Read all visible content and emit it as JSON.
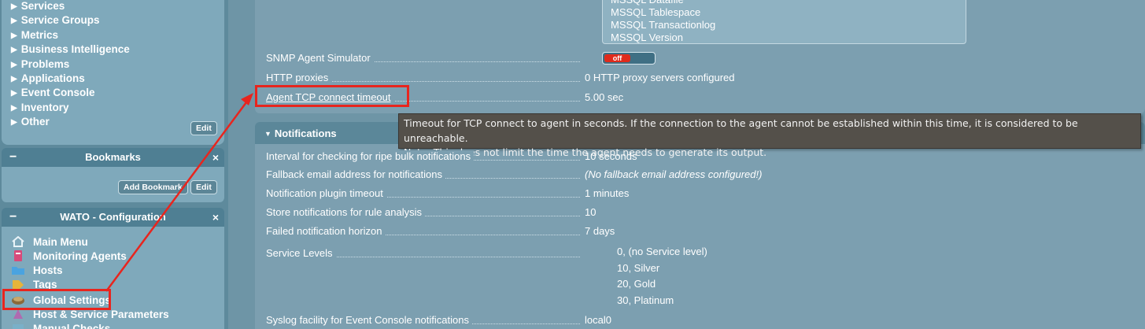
{
  "sidebar": {
    "views_items": [
      {
        "label": "Services"
      },
      {
        "label": "Service Groups"
      },
      {
        "label": "Metrics"
      },
      {
        "label": "Business Intelligence"
      },
      {
        "label": "Problems"
      },
      {
        "label": "Applications"
      },
      {
        "label": "Event Console"
      },
      {
        "label": "Inventory"
      },
      {
        "label": "Other"
      }
    ],
    "views_edit_label": "Edit",
    "bookmarks": {
      "title": "Bookmarks",
      "add_label": "Add Bookmark",
      "edit_label": "Edit"
    },
    "wato": {
      "title": "WATO - Configuration",
      "items": [
        {
          "label": "Main Menu",
          "icon": "home-icon"
        },
        {
          "label": "Monitoring Agents",
          "icon": "agent-icon"
        },
        {
          "label": "Hosts",
          "icon": "folder-icon"
        },
        {
          "label": "Tags",
          "icon": "tag-icon"
        },
        {
          "label": "Global Settings",
          "icon": "settings-icon"
        },
        {
          "label": "Host & Service Parameters",
          "icon": "parameters-icon"
        },
        {
          "label": "Manual Checks",
          "icon": "checks-icon"
        }
      ]
    },
    "minus_symbol": "−",
    "close_symbol": "×"
  },
  "main": {
    "listbox_items": [
      "MSSQL Datafile",
      "MSSQL Tablespace",
      "MSSQL Transactionlog",
      "MSSQL Version"
    ],
    "settings": [
      {
        "label": "SNMP Agent Simulator",
        "value": "off"
      },
      {
        "label": "HTTP proxies",
        "value": "0 HTTP proxy servers configured"
      },
      {
        "label": "Agent TCP connect timeout",
        "value": "5.00 sec"
      }
    ],
    "notifications": {
      "title": "Notifications",
      "rows": [
        {
          "label": "Interval for checking for ripe bulk notifications",
          "value": "10 seconds"
        },
        {
          "label": "Fallback email address for notifications",
          "value": "(No fallback email address configured!)"
        },
        {
          "label": "Notification plugin timeout",
          "value": "1 minutes"
        },
        {
          "label": "Store notifications for rule analysis",
          "value": "10"
        },
        {
          "label": "Failed notification horizon",
          "value": "7 days"
        },
        {
          "label": "Service Levels",
          "value": ""
        },
        {
          "label": "Syslog facility for Event Console notifications",
          "value": "local0"
        }
      ],
      "service_levels": [
        "0, (no Service level)",
        "10, Silver",
        "20, Gold",
        "30, Platinum"
      ]
    },
    "tooltip": {
      "line1": "Timeout for TCP connect to agent in seconds. If the connection to the agent cannot be established within this time, it is considered to be unreachable.",
      "line2": "Note: This does not limit the time the agent needs to generate its output."
    }
  },
  "colors": {
    "highlight": "#e8251e",
    "toggle_off": "#e02b1c"
  }
}
